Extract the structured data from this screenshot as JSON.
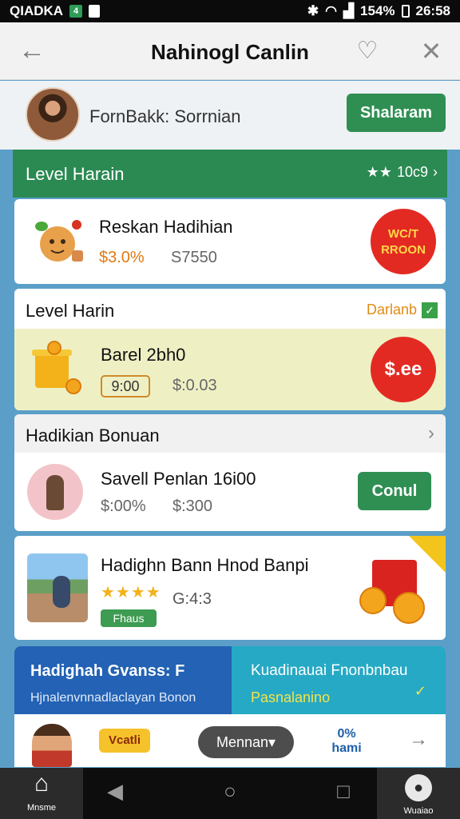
{
  "status_bar": {
    "carrier": "QIADKA",
    "battery": "154%",
    "time": "26:58"
  },
  "header": {
    "title": "Nahinogl Canlin"
  },
  "profile": {
    "name": "FornBakk: Sorrnian",
    "button": "Shalaram"
  },
  "level_bar": {
    "label": "Level Harain",
    "stars": "★★",
    "count": "10c9"
  },
  "card1": {
    "title": "Reskan Hadihian",
    "price_current": "$3.0%",
    "price_old": "S7550",
    "badge": "WC/T RROON"
  },
  "section2": {
    "title": "Level Harin",
    "link": "Darlanb",
    "item_title": "Barel 2bh0",
    "code": "9:00",
    "price": "$:0.03",
    "badge": "$.ee"
  },
  "section3": {
    "title": "Hadikian Bonuan",
    "item_title": "Savell Penlan 16i00",
    "price_a": "$:00%",
    "price_b": "$:300",
    "cta": "Conul"
  },
  "card4": {
    "title": "Hadighn Bann Hnod Banpi",
    "stars": "★★★★",
    "rating": "G:4:3",
    "tag": "Fhaus"
  },
  "promo_left": {
    "title": "Hadighah Gvanss: F",
    "subtitle": "Hjnalenvnnadlaclayan Bonon"
  },
  "promo_right": {
    "title": "Kuadinauai Fnonbnbau",
    "subtitle": "Pasnalanino"
  },
  "bottom_strip": {
    "voucher": "Vcatli",
    "menu": "Mennan▾",
    "pct_top": "0%",
    "pct_bottom": "hami"
  },
  "nav": {
    "home": "Mnsme",
    "user": "Wuaiao"
  },
  "colors": {
    "primary_green": "#2a8a52",
    "promo_blue": "#2362b4",
    "promo_teal": "#26a9c4",
    "accent_orange": "#e07a13",
    "badge_red": "#e32a22"
  }
}
